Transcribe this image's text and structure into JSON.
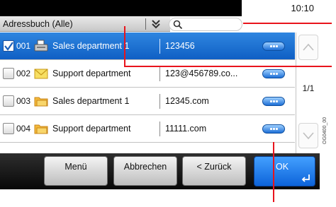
{
  "status": {
    "time": "10:10"
  },
  "filter": {
    "label": "Adressbuch (Alle)",
    "search_placeholder": ""
  },
  "entries": [
    {
      "num": "001",
      "name": "Sales department 1",
      "address": "123456",
      "type": "fax",
      "selected": true
    },
    {
      "num": "002",
      "name": "Support department",
      "address": "123@456789.co...",
      "type": "email",
      "selected": false
    },
    {
      "num": "003",
      "name": "Sales department 1",
      "address": "12345.com",
      "type": "folder",
      "selected": false
    },
    {
      "num": "004",
      "name": "Support department",
      "address": "11111.com",
      "type": "folder",
      "selected": false
    }
  ],
  "pager": {
    "label": "1/1"
  },
  "buttons": {
    "menu": "Menü",
    "cancel": "Abbrechen",
    "back": "< Zurück",
    "ok": "OK"
  },
  "figure_code": "OG0400_00",
  "colors": {
    "selection": "#1a72d6",
    "callout": "#e8141c",
    "bottom_bar": "#111111"
  }
}
